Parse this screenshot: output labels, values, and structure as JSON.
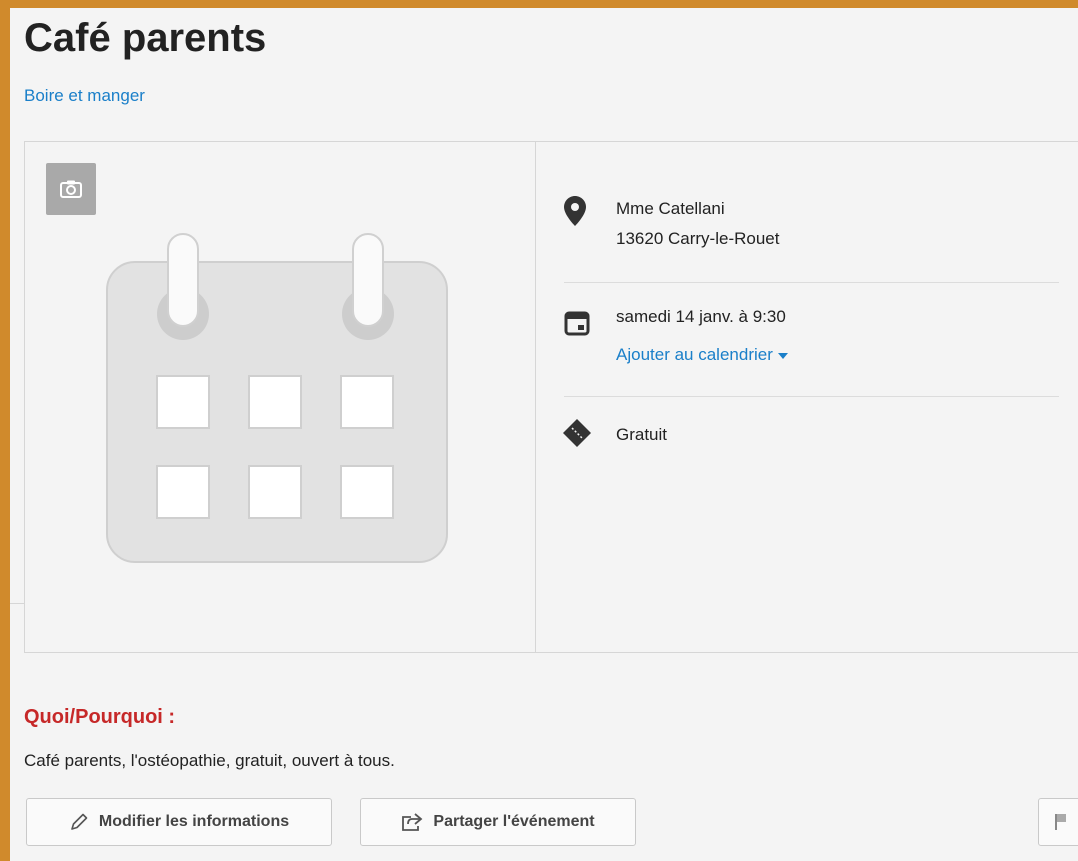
{
  "event": {
    "title": "Café parents",
    "category": "Boire et manger"
  },
  "details": {
    "location_name": "Mme Catellani",
    "location_city": "13620 Carry-le-Rouet",
    "date": "samedi 14 janv. à 9:30",
    "add_calendar": "Ajouter au calendrier",
    "price": "Gratuit"
  },
  "description": {
    "heading": "Quoi/Pourquoi :",
    "text": "Café parents, l'ostéopathie, gratuit, ouvert à tous."
  },
  "actions": {
    "edit_label": "Modifier les informations",
    "share_label": "Partager l'événement"
  },
  "icons": {
    "camera": "camera-icon",
    "calendar_placeholder": "calendar-placeholder-icon",
    "location": "map-pin-icon",
    "date": "calendar-icon",
    "price": "ticket-icon",
    "edit": "pencil-icon",
    "share": "share-icon",
    "flag": "flag-icon"
  },
  "colors": {
    "link": "#1a7fc9",
    "heading_red": "#c62828",
    "frame": "#d08a2c"
  }
}
